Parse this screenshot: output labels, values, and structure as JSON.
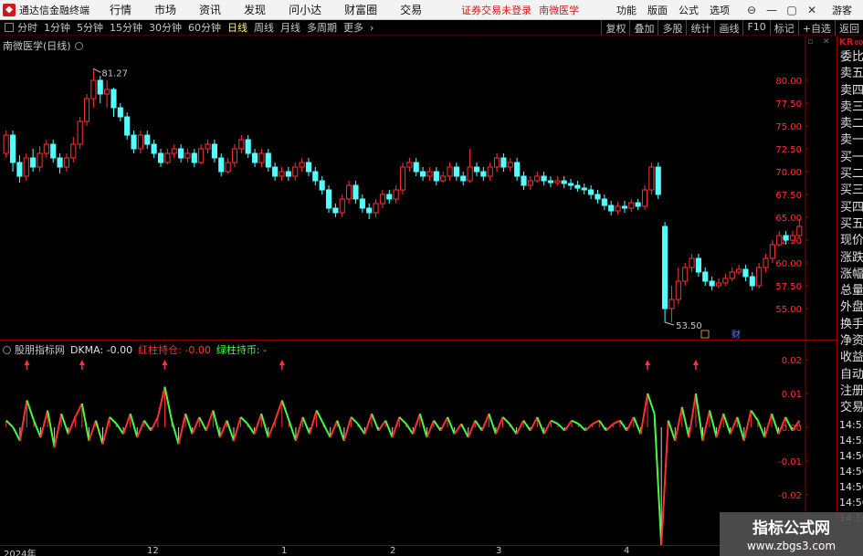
{
  "app": {
    "title": "通达信金融终端",
    "menu": [
      "行情",
      "市场",
      "资讯",
      "发现",
      "问小达",
      "财富圈",
      "交易"
    ],
    "notice": "证券交易未登录",
    "stock_name": "南微医学",
    "right_menu": [
      "功能",
      "版面",
      "公式",
      "选项"
    ],
    "guest": "游客"
  },
  "toolbar": {
    "periods": [
      "分时",
      "1分钟",
      "5分钟",
      "15分钟",
      "30分钟",
      "60分钟",
      "日线",
      "周线",
      "月线",
      "多周期",
      "更多"
    ],
    "active_period": "日线",
    "right_buttons": [
      "复权",
      "叠加",
      "多股",
      "统计",
      "画线",
      "F10",
      "标记",
      "+自选",
      "返回"
    ]
  },
  "main_chart": {
    "legend": "南微医学(日线)",
    "high_label": "81.27",
    "low_label": "53.50",
    "y_ticks": [
      "80.00",
      "77.50",
      "75.00",
      "72.50",
      "70.00",
      "67.50",
      "65.00",
      "62.50",
      "60.00",
      "57.50",
      "55.00"
    ],
    "marker_cai": "财"
  },
  "indicator": {
    "name": "股朋指标网",
    "dkma_label": "DKMA: -0.00",
    "red_label": "红柱持仓: -0.00",
    "green_label": "绿柱持币: -",
    "y_ticks": [
      "0.02",
      "0.01",
      "0.00",
      "-0.01",
      "-0.02"
    ]
  },
  "date_axis": [
    "2024年",
    "12",
    "1",
    "2",
    "3",
    "4"
  ],
  "right_col": {
    "badge": "KR",
    "badge_sub": "000",
    "items": [
      "委比",
      "卖五",
      "卖四",
      "卖三",
      "卖二",
      "卖一",
      "买一",
      "买二",
      "买三",
      "买四",
      "买五",
      "现价",
      "涨跌",
      "涨幅",
      "总量",
      "外盘",
      "换手",
      "净资",
      "收益",
      "自动",
      "注册",
      "交易"
    ],
    "times": [
      "14:55",
      "14:55",
      "14:56",
      "14:56",
      "14:56",
      "14:56",
      "14:56"
    ]
  },
  "watermark": {
    "line1": "指标公式网",
    "line2": "www.zbgs3.com"
  },
  "colors": {
    "up": "#ff3232",
    "down": "#54ffff",
    "red_line": "#ff3030",
    "green_line": "#40ff40",
    "accent": "#d01818"
  },
  "chart_data": {
    "type": "candlestick",
    "ylim": [
      53,
      83
    ],
    "candles": [
      [
        72,
        74,
        74.5,
        71.5
      ],
      [
        74,
        71,
        74.5,
        70
      ],
      [
        71,
        69.5,
        71.8,
        68.8
      ],
      [
        69.5,
        71.5,
        72,
        69
      ],
      [
        71.5,
        70.5,
        72.5,
        70
      ],
      [
        70.5,
        72,
        72.8,
        70
      ],
      [
        72,
        73,
        73.5,
        71.5
      ],
      [
        73,
        71.5,
        73.5,
        71
      ],
      [
        71.5,
        70.5,
        72,
        69.8
      ],
      [
        70.5,
        71.5,
        72,
        70
      ],
      [
        71.5,
        73,
        73.8,
        71
      ],
      [
        73,
        75.5,
        76,
        72.5
      ],
      [
        75.5,
        78,
        78.5,
        75
      ],
      [
        78,
        80,
        81.27,
        77
      ],
      [
        80,
        78.5,
        80.5,
        77.5
      ],
      [
        78.5,
        79,
        80,
        77
      ],
      [
        79,
        77,
        79.2,
        76
      ],
      [
        77,
        76,
        77.5,
        75.5
      ],
      [
        76,
        74,
        76.5,
        73.5
      ],
      [
        74,
        72.5,
        74.5,
        72
      ],
      [
        72.5,
        74,
        74.5,
        72
      ],
      [
        74,
        73,
        74.5,
        72.5
      ],
      [
        73,
        72,
        73.5,
        71.5
      ],
      [
        72,
        71,
        72.5,
        70.5
      ],
      [
        71,
        72,
        72.5,
        70.8
      ],
      [
        72,
        72.5,
        73,
        71.5
      ],
      [
        72.5,
        71.5,
        73,
        71
      ],
      [
        71.5,
        72,
        72.5,
        71
      ],
      [
        72,
        71,
        72.5,
        70.5
      ],
      [
        71,
        72.5,
        73,
        70.8
      ],
      [
        72.5,
        73,
        73.5,
        72
      ],
      [
        73,
        71.5,
        73.5,
        71
      ],
      [
        71.5,
        70,
        72,
        69.5
      ],
      [
        70,
        71,
        71.5,
        69.8
      ],
      [
        71,
        72.5,
        73,
        70.5
      ],
      [
        72.5,
        73.5,
        74,
        72
      ],
      [
        73.5,
        72,
        74,
        71.5
      ],
      [
        72,
        71,
        72.5,
        70.5
      ],
      [
        71,
        72,
        72.5,
        70.5
      ],
      [
        72,
        70.5,
        72.5,
        70
      ],
      [
        70.5,
        69.5,
        71,
        69
      ],
      [
        69.5,
        70,
        70.5,
        69
      ],
      [
        70,
        69.5,
        70.5,
        69
      ],
      [
        69.5,
        70.5,
        71,
        69
      ],
      [
        70.5,
        71,
        71.5,
        70
      ],
      [
        71,
        70,
        71.5,
        69.5
      ],
      [
        70,
        69,
        70.5,
        68.5
      ],
      [
        69,
        68,
        69.5,
        67.5
      ],
      [
        68,
        66,
        68.5,
        65.5
      ],
      [
        66,
        65.5,
        66.5,
        65
      ],
      [
        65.5,
        67,
        67.5,
        65
      ],
      [
        67,
        68.5,
        69,
        66.5
      ],
      [
        68.5,
        67,
        69,
        66.5
      ],
      [
        67,
        66,
        67.5,
        65.5
      ],
      [
        66,
        65.5,
        66.5,
        64.8
      ],
      [
        65.5,
        66.5,
        67,
        65
      ],
      [
        66.5,
        67.5,
        68,
        66
      ],
      [
        67.5,
        67,
        68,
        66.5
      ],
      [
        67,
        68,
        68.5,
        66.5
      ],
      [
        68,
        70.5,
        71,
        67.5
      ],
      [
        70.5,
        71,
        71.5,
        70
      ],
      [
        71,
        70,
        71.5,
        69.5
      ],
      [
        70,
        69.5,
        70.5,
        69
      ],
      [
        69.5,
        70,
        70.5,
        69
      ],
      [
        70,
        69,
        70.5,
        68.5
      ],
      [
        69,
        69.5,
        70,
        68.8
      ],
      [
        69.5,
        70.5,
        71,
        69
      ],
      [
        70.5,
        69.5,
        71,
        69
      ],
      [
        69.5,
        69,
        70,
        68.5
      ],
      [
        69,
        70.5,
        72.5,
        68.8
      ],
      [
        70.5,
        70,
        71,
        69.5
      ],
      [
        70,
        69.5,
        70.5,
        69
      ],
      [
        69.5,
        70.5,
        71,
        69
      ],
      [
        70.5,
        71.5,
        72,
        70
      ],
      [
        71.5,
        70.5,
        72,
        70
      ],
      [
        70.5,
        71,
        71.5,
        70
      ],
      [
        71,
        69.5,
        71.5,
        69
      ],
      [
        69.5,
        68.5,
        70,
        68
      ],
      [
        68.5,
        69,
        69.5,
        68
      ],
      [
        69,
        69.5,
        70,
        68.8
      ],
      [
        69.5,
        69,
        70,
        68.5
      ],
      [
        69,
        68.8,
        69.5,
        68.3
      ],
      [
        68.8,
        69,
        69.5,
        68.5
      ],
      [
        69,
        68.7,
        69.5,
        68.2
      ],
      [
        68.7,
        68.5,
        69.2,
        68
      ],
      [
        68.5,
        68.2,
        69,
        67.8
      ],
      [
        68.2,
        68,
        68.7,
        67.5
      ],
      [
        68,
        67.5,
        68.5,
        67
      ],
      [
        67.5,
        67,
        68,
        66.5
      ],
      [
        67,
        66.3,
        67.5,
        65.8
      ],
      [
        66.3,
        65.7,
        66.8,
        65.2
      ],
      [
        65.7,
        66.2,
        66.7,
        65.3
      ],
      [
        66.2,
        66,
        66.8,
        65.5
      ],
      [
        66,
        66.6,
        67,
        65.6
      ],
      [
        66.6,
        66.2,
        67,
        65.8
      ],
      [
        66.2,
        68,
        68.5,
        65.8
      ],
      [
        68,
        70.5,
        71,
        67.5
      ],
      [
        70.5,
        67.5,
        71,
        67
      ],
      [
        64,
        55,
        64.5,
        53.5
      ],
      [
        55,
        56,
        57.5,
        53.5
      ],
      [
        56,
        58,
        59.5,
        55.5
      ],
      [
        58,
        59.5,
        60,
        57.5
      ],
      [
        59.5,
        60.5,
        61,
        59
      ],
      [
        60.5,
        59,
        61,
        58.5
      ],
      [
        59,
        58,
        59.5,
        57.5
      ],
      [
        58,
        57.5,
        58.5,
        57
      ],
      [
        57.5,
        57.8,
        58.3,
        57.2
      ],
      [
        57.8,
        58.3,
        58.8,
        57.5
      ],
      [
        58.3,
        59,
        59.5,
        58
      ],
      [
        59,
        59.3,
        59.8,
        58.7
      ],
      [
        59.3,
        58.5,
        59.8,
        58
      ],
      [
        58.5,
        57.5,
        59,
        57
      ],
      [
        57.5,
        59.5,
        60,
        57.2
      ],
      [
        59.5,
        60.5,
        61,
        59
      ],
      [
        60.5,
        62,
        62.5,
        60
      ],
      [
        62,
        63,
        63.5,
        61.8
      ],
      [
        63,
        62.5,
        63.5,
        62
      ],
      [
        62.5,
        63,
        63.5,
        62.2
      ],
      [
        63,
        64,
        64.8,
        62.8
      ]
    ],
    "indicator_values": [
      0.002,
      0.0,
      -0.004,
      0.008,
      0.002,
      -0.003,
      0.005,
      -0.006,
      0.004,
      -0.002,
      0.003,
      0.007,
      -0.004,
      0.002,
      -0.005,
      0.003,
      0.001,
      -0.002,
      0.004,
      -0.003,
      0.002,
      -0.001,
      0.003,
      0.012,
      0.002,
      -0.005,
      0.004,
      -0.002,
      0.003,
      -0.001,
      0.005,
      -0.003,
      0.002,
      -0.004,
      0.003,
      0.001,
      -0.002,
      0.004,
      -0.003,
      0.002,
      0.008,
      0.002,
      -0.004,
      0.003,
      -0.002,
      0.005,
      0.001,
      -0.003,
      0.002,
      -0.004,
      0.003,
      0.001,
      -0.002,
      0.004,
      -0.001,
      0.002,
      -0.003,
      0.003,
      0.001,
      -0.002,
      0.004,
      -0.003,
      0.002,
      -0.001,
      0.003,
      -0.002,
      0.001,
      -0.003,
      0.002,
      -0.001,
      0.004,
      -0.002,
      0.003,
      0.001,
      -0.002,
      0.002,
      -0.001,
      0.003,
      -0.002,
      0.002,
      0.001,
      -0.001,
      0.002,
      0.001,
      -0.001,
      0.001,
      0.002,
      -0.001,
      0.001,
      0.002,
      -0.001,
      0.003,
      -0.002,
      0.01,
      0.004,
      -0.035,
      0.002,
      -0.004,
      0.006,
      -0.003,
      0.01,
      -0.004,
      0.005,
      -0.003,
      0.004,
      -0.002,
      0.003,
      -0.004,
      0.005,
      0.002,
      -0.003,
      0.004,
      -0.002,
      0.003,
      -0.001,
      0.002
    ]
  }
}
